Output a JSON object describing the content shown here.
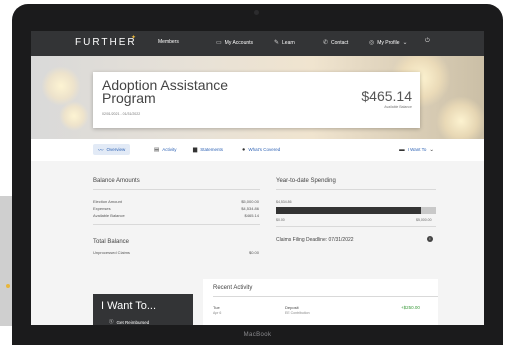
{
  "device": {
    "label": "MacBook"
  },
  "nav": {
    "logo": "FURTHER",
    "items": [
      {
        "label": "Members",
        "icon": "none"
      },
      {
        "label": "My Accounts",
        "icon": "card-icon"
      },
      {
        "label": "Learn",
        "icon": "learn-icon"
      },
      {
        "label": "Contact",
        "icon": "phone-icon"
      },
      {
        "label": "My Profile",
        "icon": "user-icon"
      }
    ]
  },
  "hero": {
    "plan_name": "Adoption Assistance Program",
    "plan_dates": "02/01/2021 - 01/31/2022",
    "balance": "$465.14",
    "balance_label": "Available Balance"
  },
  "tabs": [
    {
      "label": "Overview",
      "icon": "chart-line-icon",
      "active": true
    },
    {
      "label": "Activity",
      "icon": "list-icon",
      "active": false
    },
    {
      "label": "Statements",
      "icon": "document-icon",
      "active": false
    },
    {
      "label": "What's Covered",
      "icon": "check-circle-icon",
      "active": false
    }
  ],
  "iwant_dropdown": {
    "label": "I Want To"
  },
  "balance_amounts": {
    "title": "Balance Amounts",
    "rows": [
      {
        "label": "Election Amount",
        "value": "$5,000.00"
      },
      {
        "label": "Expenses",
        "value": "$4,534.86"
      },
      {
        "label": "Available Balance",
        "value": "$465.14"
      }
    ]
  },
  "total_balance": {
    "title": "Total Balance",
    "rows": [
      {
        "label": "Unprocessed Claims",
        "value": "$0.00"
      }
    ]
  },
  "ytd": {
    "title": "Year-to-date Spending",
    "spent_label": "$4,534.86",
    "min_label": "$0.00",
    "max_label": "$5,000.00",
    "fraction": 0.907,
    "deadline": "Claims Filing Deadline: 07/31/2022"
  },
  "iwant_box": {
    "title": "I Want To...",
    "item": "Get Reimbursed"
  },
  "recent_activity": {
    "title": "Recent Activity",
    "items": [
      {
        "day": "Tue",
        "date": "Apr 6",
        "type": "Deposit",
        "desc": "EE Contribution",
        "amount": "+$250.00"
      }
    ]
  }
}
